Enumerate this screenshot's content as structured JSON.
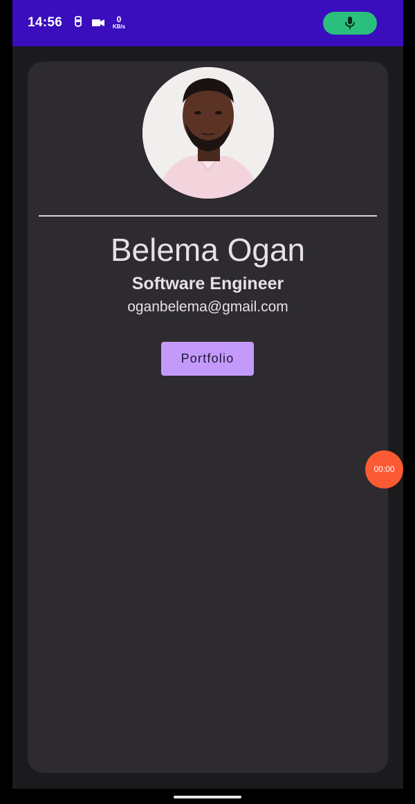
{
  "status_bar": {
    "time": "14:56",
    "net_speed_value": "0",
    "net_speed_unit": "KB/s",
    "icons": [
      "notification-tile-icon",
      "video-camera-icon"
    ],
    "mic_icon": "microphone-icon",
    "colors": {
      "background": "#3a0dbd",
      "mic_pill": "#2bbf7e"
    }
  },
  "profile": {
    "avatar": "profile-photo",
    "name": "Belema Ogan",
    "title": "Software Engineer",
    "email": "oganbelema@gmail.com",
    "button_label": "Portfolio"
  },
  "screen_recorder": {
    "timer": "00:00"
  },
  "colors": {
    "card": "#2d2b2f",
    "screen_background": "#1b1a1d",
    "button": "#c39afc",
    "timer_bubble": "#fb5a33"
  }
}
